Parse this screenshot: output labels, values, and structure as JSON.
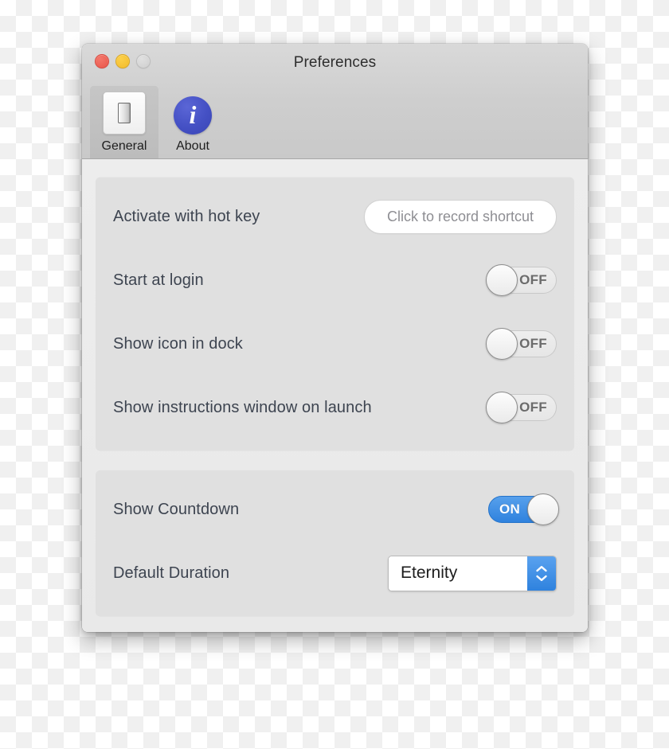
{
  "window": {
    "title": "Preferences",
    "controls": [
      {
        "name": "close",
        "color": "#e8554a"
      },
      {
        "name": "minimize",
        "color": "#f2bb2b"
      },
      {
        "name": "zoom",
        "color": "#cfcfcf"
      }
    ]
  },
  "toolbar": {
    "tabs": [
      {
        "label": "General",
        "icon": "light-switch-icon",
        "selected": true
      },
      {
        "label": "About",
        "icon": "info-circle-icon",
        "selected": false
      }
    ]
  },
  "sections": [
    {
      "name": "general-settings",
      "rows": [
        {
          "label": "Activate with hot key",
          "control": "hotkey-recorder",
          "placeholder": "Click to record shortcut",
          "value": ""
        },
        {
          "label": "Start at login",
          "control": "toggle",
          "state": "OFF"
        },
        {
          "label": "Show icon in dock",
          "control": "toggle",
          "state": "OFF"
        },
        {
          "label": "Show instructions window on launch",
          "control": "toggle",
          "state": "OFF"
        }
      ]
    },
    {
      "name": "countdown-settings",
      "rows": [
        {
          "label": "Show Countdown",
          "control": "toggle",
          "state": "ON"
        },
        {
          "label": "Default Duration",
          "control": "popup-button",
          "value": "Eternity"
        }
      ]
    }
  ],
  "colors": {
    "accent_blue": "#2f82de",
    "toggle_on_track": "#3b8ee8",
    "label_text": "#3d4450",
    "placeholder_text": "#8e8e93",
    "panel_bg": "#e0e0e0",
    "content_bg": "#ebebeb",
    "toolbar_bg": "#cecece",
    "about_icon_blue": "#4450c4"
  }
}
